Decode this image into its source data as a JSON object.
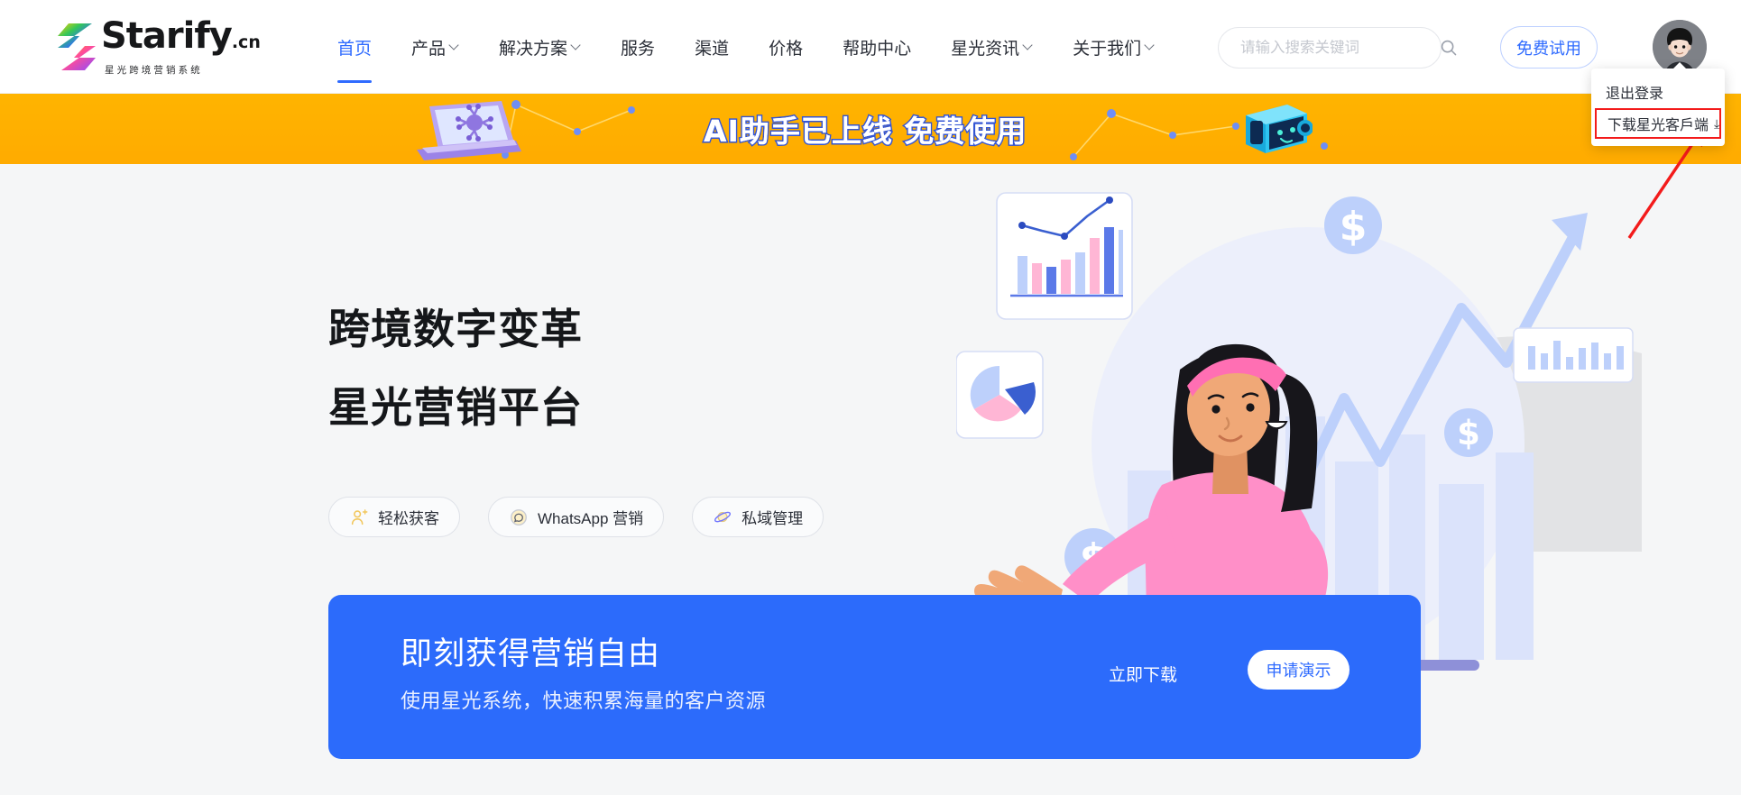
{
  "brand": {
    "name": "Starify",
    "suffix": ".cn",
    "tagline": "星光跨境营销系统",
    "logo_icon": "starify-s-logo-icon"
  },
  "nav": {
    "items": [
      {
        "label": "首页",
        "active": true,
        "has_dropdown": false
      },
      {
        "label": "产品",
        "active": false,
        "has_dropdown": true
      },
      {
        "label": "解决方案",
        "active": false,
        "has_dropdown": true
      },
      {
        "label": "服务",
        "active": false,
        "has_dropdown": false
      },
      {
        "label": "渠道",
        "active": false,
        "has_dropdown": false
      },
      {
        "label": "价格",
        "active": false,
        "has_dropdown": false
      },
      {
        "label": "帮助中心",
        "active": false,
        "has_dropdown": false
      },
      {
        "label": "星光资讯",
        "active": false,
        "has_dropdown": true
      },
      {
        "label": "关于我们",
        "active": false,
        "has_dropdown": true
      }
    ]
  },
  "search": {
    "placeholder": "请输入搜索关键词",
    "value": "",
    "icon": "search-icon"
  },
  "header_actions": {
    "trial_label": "免费试用",
    "avatar_icon": "user-avatar"
  },
  "user_menu": {
    "logout_label": "退出登录",
    "download_label": "下载星光客戶端",
    "download_glyph": "⤓",
    "highlight_color": "#f31b1b"
  },
  "banner": {
    "text": "AI助手已上线 免费使用",
    "background_color": "#ffb400",
    "text_color": "#ffffff",
    "outline_color": "#3355d4",
    "left_icon": "laptop-ai-icon",
    "right_icon": "robot-head-icon"
  },
  "hero": {
    "title_line1": "跨境数字变革",
    "title_line2": "星光营销平台",
    "pills": [
      {
        "label": "轻松获客",
        "icon": "user-add-icon"
      },
      {
        "label": "WhatsApp 营销",
        "icon": "whatsapp-circle-icon"
      },
      {
        "label": "私域管理",
        "icon": "planet-icon"
      }
    ],
    "illustration": "marketing-analytics-illustration"
  },
  "cta": {
    "title": "即刻获得营销自由",
    "subtitle": "使用星光系统，快速积累海量的客户资源",
    "download_label": "立即下载",
    "demo_label": "申请演示",
    "background_color": "#2c6bfb"
  },
  "colors": {
    "accent_blue": "#2f6bff",
    "banner_orange": "#ffb400",
    "page_bg": "#f5f6f7"
  }
}
